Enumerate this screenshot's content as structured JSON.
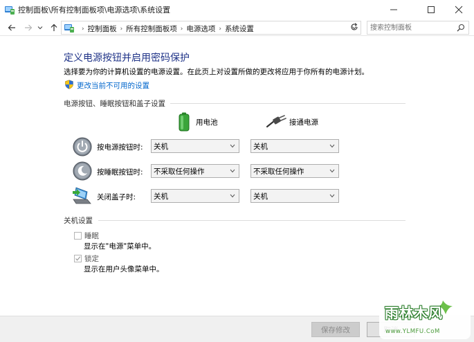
{
  "window": {
    "title": "控制面板\\所有控制面板项\\电源选项\\系统设置"
  },
  "nav": {
    "breadcrumbs": [
      "控制面板",
      "所有控制面板项",
      "电源选项",
      "系统设置"
    ],
    "search_placeholder": "搜索控制面板"
  },
  "main": {
    "title": "定义电源按钮并启用密码保护",
    "description": "选择要为你的计算机设置的电源设置。在此页上对设置所做的更改将应用于你所有的电源计划。",
    "change_link": "更改当前不可用的设置",
    "buttons_group": {
      "title": "电源按钮、睡眠按钮和盖子设置",
      "battery_label": "用电池",
      "plugged_label": "接通电源",
      "rows": [
        {
          "label": "按电源按钮时:",
          "battery": "关机",
          "plugged": "关机"
        },
        {
          "label": "按睡眠按钮时:",
          "battery": "不采取任何操作",
          "plugged": "不采取任何操作"
        },
        {
          "label": "关闭盖子时:",
          "battery": "关机",
          "plugged": "关机"
        }
      ]
    },
    "shutdown_group": {
      "title": "关机设置",
      "items": [
        {
          "label": "睡眠",
          "description": "显示在\"电源\"菜单中。",
          "checked": false
        },
        {
          "label": "锁定",
          "description": "显示在用户头像菜单中。",
          "checked": true
        }
      ]
    }
  },
  "footer": {
    "save_label": "保存修改",
    "cancel_label": "取消"
  },
  "watermark": {
    "text": "雨林木风",
    "url": "www.YLMFU.CoM"
  },
  "colors": {
    "title_blue": "#1e3287",
    "link_blue": "#0066cc",
    "battery_green": "#3aa53a"
  }
}
